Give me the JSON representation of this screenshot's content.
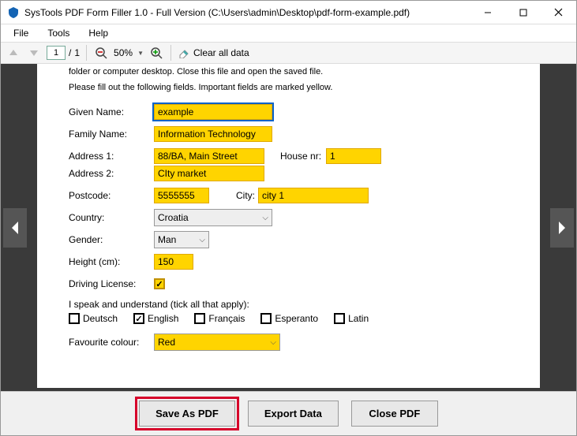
{
  "window": {
    "title": "SysTools PDF Form Filler 1.0 - Full Version (C:\\Users\\admin\\Desktop\\pdf-form-example.pdf)"
  },
  "menu": {
    "file": "File",
    "tools": "Tools",
    "help": "Help"
  },
  "toolbar": {
    "page_current": "1",
    "page_sep": "/",
    "page_total": "1",
    "zoom": "50%",
    "clear_all": "Clear all data"
  },
  "doc": {
    "line1": "folder or computer desktop. Close this file and open the saved file.",
    "line2": "Please fill out the following fields. Important fields are marked yellow."
  },
  "labels": {
    "given_name": "Given Name:",
    "family_name": "Family Name:",
    "address1": "Address 1:",
    "address2": "Address 2:",
    "house_nr": "House nr:",
    "postcode": "Postcode:",
    "city": "City:",
    "country": "Country:",
    "gender": "Gender:",
    "height": "Height (cm):",
    "driving": "Driving License:",
    "languages_intro": "I speak and understand (tick all that apply):",
    "fav_color": "Favourite colour:"
  },
  "values": {
    "given_name": "example",
    "family_name": "Information Technology",
    "address1": "88/BA, Main Street",
    "address2": "CIty market",
    "house_nr": "1",
    "postcode": "5555555",
    "city": "city 1",
    "country": "Croatia",
    "gender": "Man",
    "height": "150",
    "driving_checked": "✓",
    "fav_color": "Red"
  },
  "languages": {
    "de": "Deutsch",
    "en": "English",
    "fr": "Français",
    "eo": "Esperanto",
    "la": "Latin",
    "en_checked": "✓"
  },
  "footer": {
    "save": "Save As PDF",
    "export": "Export Data",
    "close": "Close PDF"
  }
}
